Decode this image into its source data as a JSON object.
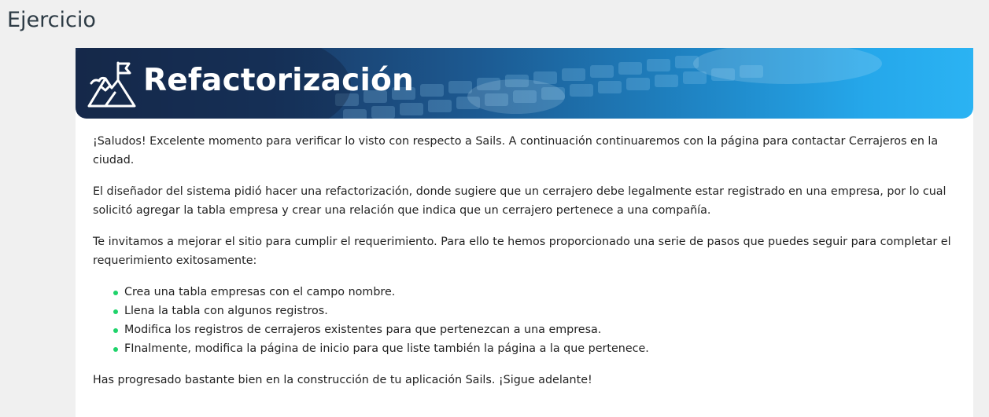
{
  "page": {
    "heading": "Ejercicio"
  },
  "banner": {
    "title": "Refactorización",
    "icon": "mountain-flag-icon"
  },
  "content": {
    "paragraphs_before": [
      "¡Saludos! Excelente momento para verificar lo visto con respecto a Sails. A continuación continuaremos con la página para contactar Cerrajeros en la ciudad.",
      "El diseñador del sistema pidió hacer una refactorización, donde sugiere que un cerrajero debe legalmente estar registrado en una empresa, por lo cual solicitó agregar la tabla empresa y crear una relación que indica que un cerrajero pertenece a una compañía.",
      "Te invitamos a mejorar el sitio para cumplir el requerimiento. Para ello te hemos proporcionado una serie de pasos que puedes seguir para completar el requerimiento exitosamente:"
    ],
    "steps": [
      "Crea una tabla empresas con el campo nombre.",
      "Llena la tabla con algunos registros.",
      "Modifica los registros de cerrajeros existentes para que pertenezcan a una empresa.",
      "FInalmente, modifica la página de inicio para que liste también la página a la que pertenece."
    ],
    "closing": "Has progresado bastante bien en la construcción de tu aplicación Sails. ¡Sigue adelante!"
  },
  "colors": {
    "bullet": "#1fd36b",
    "banner_dark": "#1a2f52",
    "banner_light": "#2bb3f3",
    "heading": "#2d3b45"
  }
}
